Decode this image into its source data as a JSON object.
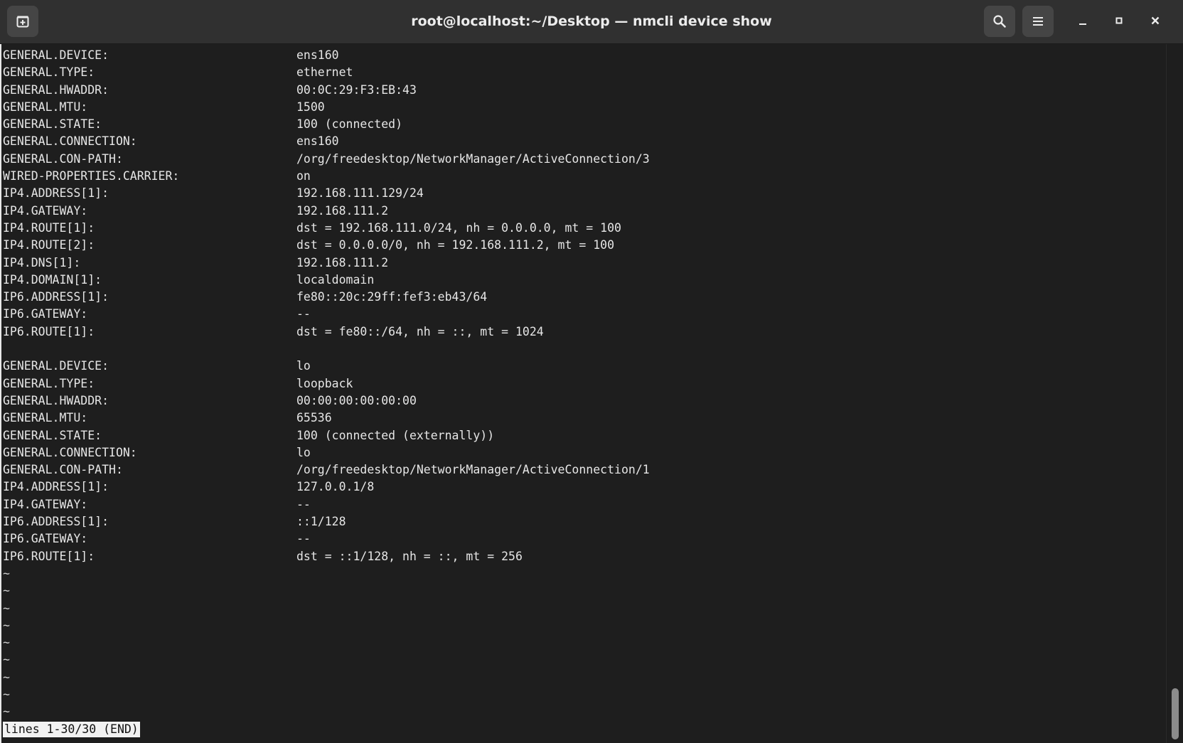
{
  "window": {
    "title": "root@localhost:~/Desktop — nmcli device show"
  },
  "icons": {
    "new_tab": "new-tab-icon",
    "search": "search-icon",
    "menu": "hamburger-menu-icon",
    "minimize": "minimize-icon",
    "maximize": "maximize-icon",
    "close": "close-icon"
  },
  "devices": [
    {
      "fields": [
        {
          "key": "GENERAL.DEVICE:",
          "value": "ens160"
        },
        {
          "key": "GENERAL.TYPE:",
          "value": "ethernet"
        },
        {
          "key": "GENERAL.HWADDR:",
          "value": "00:0C:29:F3:EB:43"
        },
        {
          "key": "GENERAL.MTU:",
          "value": "1500"
        },
        {
          "key": "GENERAL.STATE:",
          "value": "100 (connected)"
        },
        {
          "key": "GENERAL.CONNECTION:",
          "value": "ens160"
        },
        {
          "key": "GENERAL.CON-PATH:",
          "value": "/org/freedesktop/NetworkManager/ActiveConnection/3"
        },
        {
          "key": "WIRED-PROPERTIES.CARRIER:",
          "value": "on"
        },
        {
          "key": "IP4.ADDRESS[1]:",
          "value": "192.168.111.129/24"
        },
        {
          "key": "IP4.GATEWAY:",
          "value": "192.168.111.2"
        },
        {
          "key": "IP4.ROUTE[1]:",
          "value": "dst = 192.168.111.0/24, nh = 0.0.0.0, mt = 100"
        },
        {
          "key": "IP4.ROUTE[2]:",
          "value": "dst = 0.0.0.0/0, nh = 192.168.111.2, mt = 100"
        },
        {
          "key": "IP4.DNS[1]:",
          "value": "192.168.111.2"
        },
        {
          "key": "IP4.DOMAIN[1]:",
          "value": "localdomain"
        },
        {
          "key": "IP6.ADDRESS[1]:",
          "value": "fe80::20c:29ff:fef3:eb43/64"
        },
        {
          "key": "IP6.GATEWAY:",
          "value": "--"
        },
        {
          "key": "IP6.ROUTE[1]:",
          "value": "dst = fe80::/64, nh = ::, mt = 1024"
        }
      ]
    },
    {
      "fields": [
        {
          "key": "GENERAL.DEVICE:",
          "value": "lo"
        },
        {
          "key": "GENERAL.TYPE:",
          "value": "loopback"
        },
        {
          "key": "GENERAL.HWADDR:",
          "value": "00:00:00:00:00:00"
        },
        {
          "key": "GENERAL.MTU:",
          "value": "65536"
        },
        {
          "key": "GENERAL.STATE:",
          "value": "100 (connected (externally))"
        },
        {
          "key": "GENERAL.CONNECTION:",
          "value": "lo"
        },
        {
          "key": "GENERAL.CON-PATH:",
          "value": "/org/freedesktop/NetworkManager/ActiveConnection/1"
        },
        {
          "key": "IP4.ADDRESS[1]:",
          "value": "127.0.0.1/8"
        },
        {
          "key": "IP4.GATEWAY:",
          "value": "--"
        },
        {
          "key": "IP6.ADDRESS[1]:",
          "value": "::1/128"
        },
        {
          "key": "IP6.GATEWAY:",
          "value": "--"
        },
        {
          "key": "IP6.ROUTE[1]:",
          "value": "dst = ::1/128, nh = ::, mt = 256"
        }
      ]
    }
  ],
  "filler": [
    "~",
    "~",
    "~",
    "~",
    "~",
    "~",
    "~",
    "~",
    "~"
  ],
  "pager_status": "lines 1-30/30 (END)",
  "scroll_position": 1.0,
  "colors": {
    "terminal_bg": "#1e1e1e",
    "headerbar_bg": "#303030",
    "text": "#e6e6e6"
  }
}
